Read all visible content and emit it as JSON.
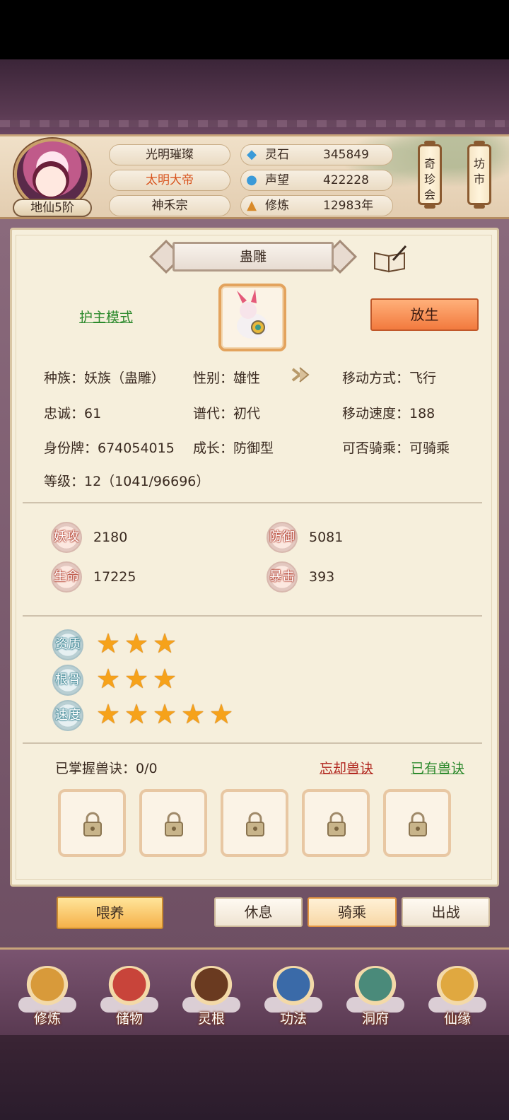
{
  "header": {
    "rank": "地仙5阶",
    "name": "光明璀璨",
    "title": "太明大帝",
    "sect": "神禾宗",
    "resources": [
      {
        "icon": "spirit-stone-icon",
        "label": "灵石",
        "value": "345849"
      },
      {
        "icon": "reputation-icon",
        "label": "声望",
        "value": "422228"
      },
      {
        "icon": "cultivation-icon",
        "label": "修炼",
        "value": "12983年"
      }
    ],
    "side_buttons": [
      {
        "label": "奇\n珍\n会"
      },
      {
        "label": "坊\n市"
      }
    ]
  },
  "pet": {
    "name": "蛊雕",
    "mode": "护主模式",
    "release": "放生",
    "info": {
      "race": "种族：妖族（蛊雕）",
      "gender": "性别：雄性",
      "move_type": "移动方式：飞行",
      "loyalty": "忠诚：61",
      "generation": "谱代：初代",
      "move_speed": "移动速度：188",
      "id_tag": "身份牌：674054015",
      "growth": "成长：防御型",
      "rideable": "可否骑乘：可骑乘",
      "level": "等级：12（1041/96696）"
    },
    "stats": [
      {
        "label": "妖攻",
        "value": "2180"
      },
      {
        "label": "防御",
        "value": "5081"
      },
      {
        "label": "生命",
        "value": "17225"
      },
      {
        "label": "暴击",
        "value": "393"
      }
    ],
    "aptitudes": [
      {
        "label": "资质",
        "stars": 3
      },
      {
        "label": "根骨",
        "stars": 3
      },
      {
        "label": "速度",
        "stars": 5
      }
    ],
    "skills": {
      "mastered": "已掌握兽诀：0/0",
      "forget": "忘却兽诀",
      "owned": "已有兽诀",
      "slots": 5
    }
  },
  "actions": {
    "feed": "喂养",
    "rest": "休息",
    "ride": "骑乘",
    "battle": "出战"
  },
  "nav": [
    {
      "icon": "cultivate-icon",
      "label": "修炼"
    },
    {
      "icon": "storage-bag-icon",
      "label": "储物"
    },
    {
      "icon": "spirit-root-icon",
      "label": "灵根"
    },
    {
      "icon": "technique-book-icon",
      "label": "功法"
    },
    {
      "icon": "cave-mansion-icon",
      "label": "洞府"
    },
    {
      "icon": "fate-gourd-icon",
      "label": "仙缘"
    }
  ],
  "colors": {
    "accent_orange": "#f27a3e",
    "link_green": "#2d8a2d",
    "link_red": "#b1271f",
    "star_gold": "#f6a21a"
  }
}
